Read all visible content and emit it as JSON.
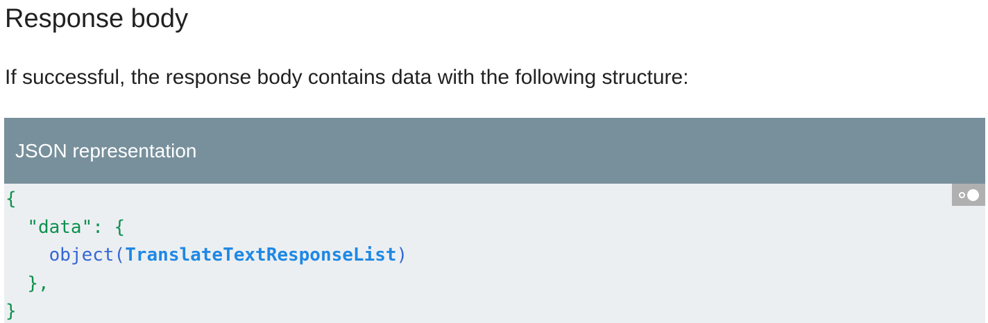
{
  "page": {
    "title": "Response body",
    "intro": "If successful, the response body contains data with the following structure:"
  },
  "json_panel": {
    "header": "JSON representation",
    "toggle_icon": "toggle-dots-icon",
    "code": {
      "open_brace": "{",
      "indent1": "  ",
      "key": "\"data\"",
      "colon": ": ",
      "inner_open": "{",
      "indent2": "    ",
      "type_keyword": "object",
      "paren_open": "(",
      "type_name": "TranslateTextResponseList",
      "paren_close": ")",
      "inner_close": "},",
      "close_brace": "}"
    }
  },
  "colors": {
    "header_bg": "#78909c",
    "code_bg": "#eceff1",
    "green": "#0d904f",
    "keyword_blue": "#3367d6",
    "link_blue": "#1e88e5"
  }
}
